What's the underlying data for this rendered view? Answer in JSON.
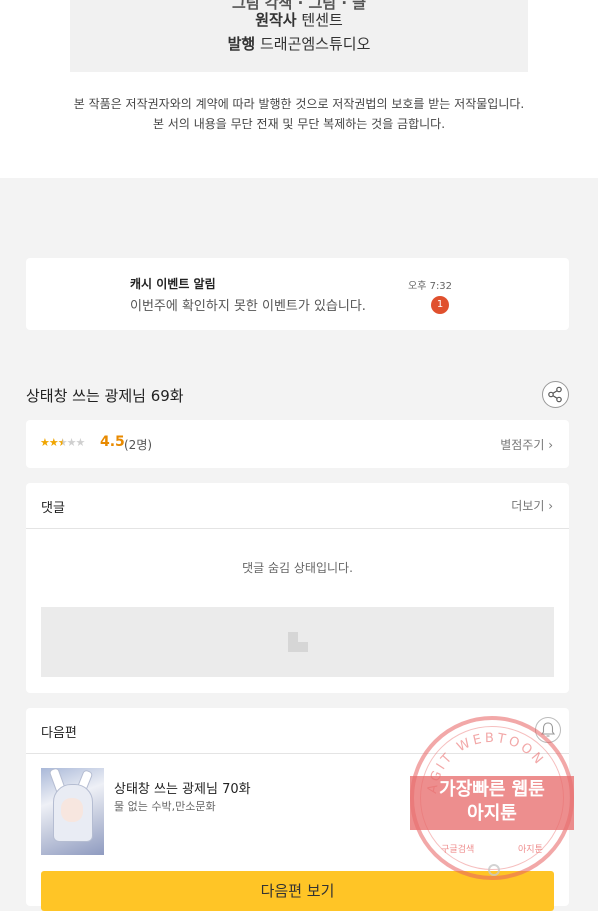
{
  "credits": {
    "row1": "그림 각색 · 그림 · 글",
    "author_label": "원작사",
    "author_value": "텐센트",
    "publisher_label": "발행",
    "publisher_value": "드래곤엠스튜디오"
  },
  "copyright": {
    "line1": "본 작품은 저작권자와의 계약에 따라 발행한 것으로 저작권법의 보호를 받는 저작물입니다.",
    "line2": "본 서의 내용을 무단 전재 및 무단 복제하는 것을 금합니다."
  },
  "notice": {
    "title": "캐시 이벤트 알림",
    "body": "이번주에 확인하지 못한 이벤트가 있습니다.",
    "time": "오후 7:32",
    "badge": "1",
    "badge_color": "#e0502e"
  },
  "episode": {
    "title": "상태창 쓰는 광제님 69화",
    "share_icon": "share-icon"
  },
  "rating": {
    "stars_filled": 2.5,
    "stars_total": 5,
    "value": "4.5",
    "count": "(2명)",
    "rate_link": "별점주기 ›",
    "accent": "#f0a500"
  },
  "comments": {
    "title": "댓글",
    "more": "더보기 ›",
    "hidden_message": "댓글 숨김 상태입니다."
  },
  "next_episode": {
    "section_title": "다음편",
    "title": "상태창 쓰는 광제님 70화",
    "subtitle": "물 없는 수박,만소문화",
    "button_label": "다음편 보기",
    "button_color": "#ffc526"
  },
  "watermark": {
    "arc_text": "AGIT WEBTOON",
    "line1": "가장빠른 웹툰",
    "line2": "아지툰",
    "bottom_left": "구글검색",
    "bottom_right": "아지툰"
  }
}
